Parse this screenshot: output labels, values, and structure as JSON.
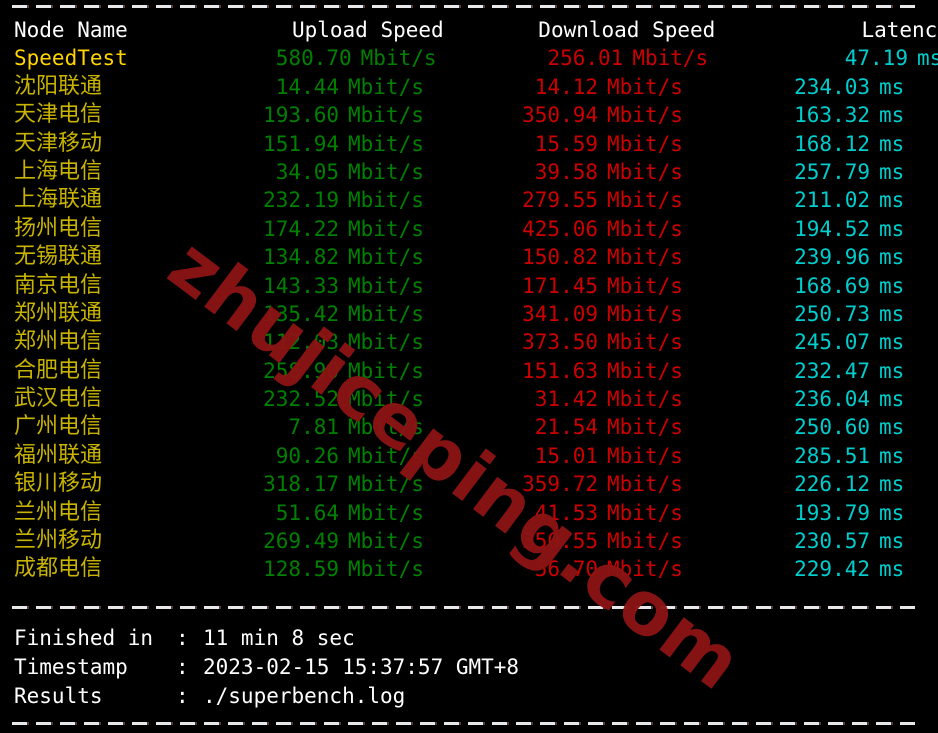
{
  "terminal": {
    "background": "#000000",
    "separator_char": "-",
    "colors": {
      "header": "#ffffff",
      "speedtest_name": "#ffd500",
      "node_name": "#c8b400",
      "upload": "#008000",
      "download": "#cd0000",
      "latency": "#00cdcd",
      "watermark": "#8c1414"
    }
  },
  "watermark": {
    "text": "zhujiceping.com"
  },
  "table": {
    "headers": {
      "node_name": "Node Name",
      "upload_speed": "Upload Speed",
      "download_speed": "Download Speed",
      "latency": "Latency"
    },
    "units": {
      "speed": "Mbit/s",
      "latency": "ms"
    },
    "summary_row": {
      "name": "SpeedTest",
      "upload": "580.70",
      "download": "256.01",
      "latency": "47.19"
    },
    "rows": [
      {
        "name": "沈阳联通",
        "upload": "14.44",
        "download": "14.12",
        "latency": "234.03"
      },
      {
        "name": "天津电信",
        "upload": "193.60",
        "download": "350.94",
        "latency": "163.32"
      },
      {
        "name": "天津移动",
        "upload": "151.94",
        "download": "15.59",
        "latency": "168.12"
      },
      {
        "name": "上海电信",
        "upload": "34.05",
        "download": "39.58",
        "latency": "257.79"
      },
      {
        "name": "上海联通",
        "upload": "232.19",
        "download": "279.55",
        "latency": "211.02"
      },
      {
        "name": "扬州电信",
        "upload": "174.22",
        "download": "425.06",
        "latency": "194.52"
      },
      {
        "name": "无锡联通",
        "upload": "134.82",
        "download": "150.82",
        "latency": "239.96"
      },
      {
        "name": "南京电信",
        "upload": "143.33",
        "download": "171.45",
        "latency": "168.69"
      },
      {
        "name": "郑州联通",
        "upload": "135.42",
        "download": "341.09",
        "latency": "250.73"
      },
      {
        "name": "郑州电信",
        "upload": "112.03",
        "download": "373.50",
        "latency": "245.07"
      },
      {
        "name": "合肥电信",
        "upload": "258.90",
        "download": "151.63",
        "latency": "232.47"
      },
      {
        "name": "武汉电信",
        "upload": "232.52",
        "download": "31.42",
        "latency": "236.04"
      },
      {
        "name": "广州电信",
        "upload": "7.81",
        "download": "21.54",
        "latency": "250.60"
      },
      {
        "name": "福州联通",
        "upload": "90.26",
        "download": "15.01",
        "latency": "285.51"
      },
      {
        "name": "银川移动",
        "upload": "318.17",
        "download": "359.72",
        "latency": "226.12"
      },
      {
        "name": "兰州电信",
        "upload": "51.64",
        "download": "41.53",
        "latency": "193.79"
      },
      {
        "name": "兰州移动",
        "upload": "269.49",
        "download": "350.55",
        "latency": "230.57"
      },
      {
        "name": "成都电信",
        "upload": "128.59",
        "download": "56.70",
        "latency": "229.42"
      }
    ]
  },
  "footer": {
    "colon": ":",
    "items": [
      {
        "label": "Finished in",
        "value": "11 min 8 sec"
      },
      {
        "label": "Timestamp",
        "value": "2023-02-15 15:37:57 GMT+8"
      },
      {
        "label": "Results",
        "value": "./superbench.log"
      }
    ]
  }
}
